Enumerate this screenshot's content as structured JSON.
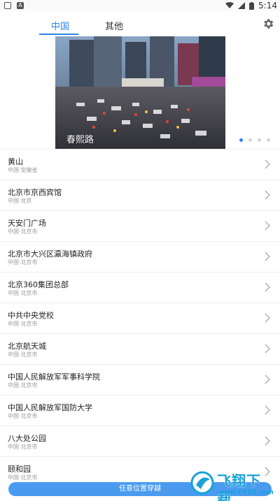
{
  "status_bar": {
    "time": "5:14"
  },
  "header": {
    "tabs": [
      {
        "label": "中国"
      },
      {
        "label": "其他"
      }
    ]
  },
  "banner": {
    "caption": "春熙路",
    "page_count": 4,
    "active_index": 0
  },
  "list": {
    "items": [
      {
        "title": "黄山",
        "subtitle": "中国·安徽省"
      },
      {
        "title": "北京市京西宾馆",
        "subtitle": "中国·北京"
      },
      {
        "title": "天安门广场",
        "subtitle": "中国·北京市"
      },
      {
        "title": "北京市大兴区瀛海镇政府",
        "subtitle": "中国·北京市"
      },
      {
        "title": "北京360集团总部",
        "subtitle": "中国·北京市"
      },
      {
        "title": "中共中央党校",
        "subtitle": "中国·北京市"
      },
      {
        "title": "北京航天城",
        "subtitle": "中国·北京市"
      },
      {
        "title": "中国人民解放军军事科学院",
        "subtitle": "中国·北京市"
      },
      {
        "title": "中国人民解放军国防大学",
        "subtitle": "中国·北京市"
      },
      {
        "title": "八大处公园",
        "subtitle": "中国·北京市"
      },
      {
        "title": "颐和园",
        "subtitle": "中国·北京市"
      }
    ]
  },
  "bottom_button": {
    "label": "任意位置穿越"
  },
  "watermark": {
    "text": "飞翔下载",
    "url": "www.FXXZ.com"
  },
  "colors": {
    "accent": "#2a85e8",
    "button": "#4a9bf0"
  }
}
